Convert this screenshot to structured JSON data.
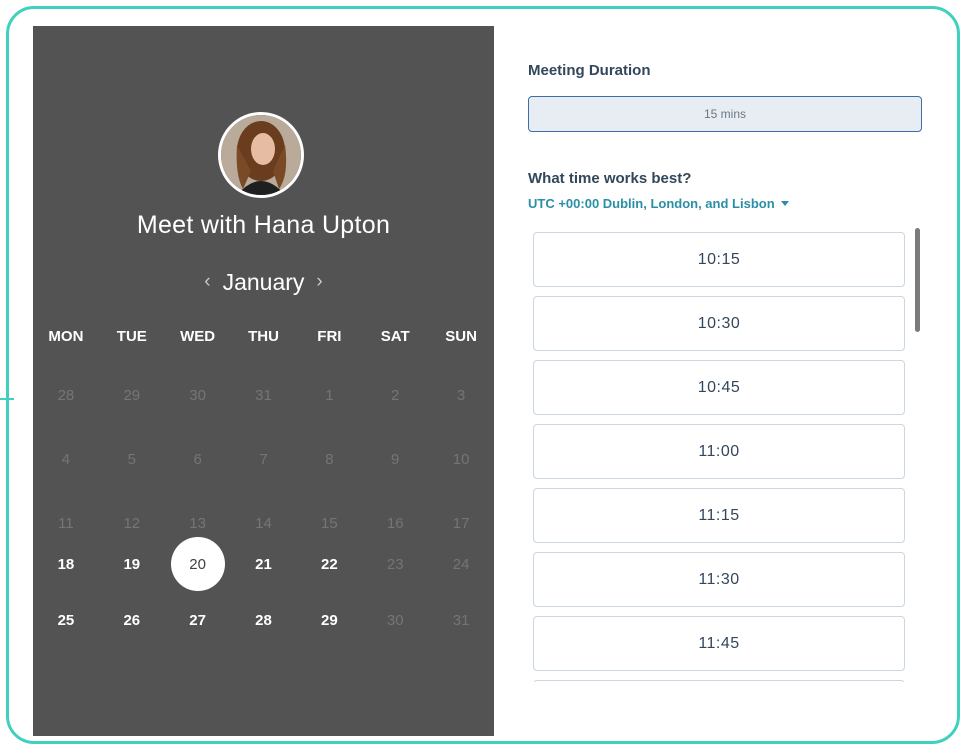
{
  "host": {
    "title": "Meet with Hana Upton"
  },
  "calendar": {
    "month": "January",
    "prev_icon": "chevron-left-icon",
    "next_icon": "chevron-right-icon",
    "weekdays": [
      "MON",
      "TUE",
      "WED",
      "THU",
      "FRI",
      "SAT",
      "SUN"
    ],
    "weeks": [
      [
        {
          "d": "28",
          "available": false
        },
        {
          "d": "29",
          "available": false
        },
        {
          "d": "30",
          "available": false
        },
        {
          "d": "31",
          "available": false
        },
        {
          "d": "1",
          "available": false
        },
        {
          "d": "2",
          "available": false
        },
        {
          "d": "3",
          "available": false
        }
      ],
      [
        {
          "d": "4",
          "available": false
        },
        {
          "d": "5",
          "available": false
        },
        {
          "d": "6",
          "available": false
        },
        {
          "d": "7",
          "available": false
        },
        {
          "d": "8",
          "available": false
        },
        {
          "d": "9",
          "available": false
        },
        {
          "d": "10",
          "available": false
        }
      ],
      [
        {
          "d": "11",
          "available": false
        },
        {
          "d": "12",
          "available": false
        },
        {
          "d": "13",
          "available": false
        },
        {
          "d": "14",
          "available": false
        },
        {
          "d": "15",
          "available": false
        },
        {
          "d": "16",
          "available": false
        },
        {
          "d": "17",
          "available": false
        }
      ],
      [
        {
          "d": "18",
          "available": true
        },
        {
          "d": "19",
          "available": true
        },
        {
          "d": "20",
          "available": true,
          "selected": true
        },
        {
          "d": "21",
          "available": true
        },
        {
          "d": "22",
          "available": true
        },
        {
          "d": "23",
          "available": false
        },
        {
          "d": "24",
          "available": false
        }
      ],
      [
        {
          "d": "25",
          "available": true
        },
        {
          "d": "26",
          "available": true
        },
        {
          "d": "27",
          "available": true
        },
        {
          "d": "28",
          "available": true
        },
        {
          "d": "29",
          "available": true
        },
        {
          "d": "30",
          "available": false
        },
        {
          "d": "31",
          "available": false
        }
      ]
    ]
  },
  "duration": {
    "label": "Meeting Duration",
    "value": "15 mins"
  },
  "times": {
    "label": "What time works best?",
    "timezone": "UTC +00:00 Dublin, London, and Lisbon",
    "slots": [
      "10:15",
      "10:30",
      "10:45",
      "11:00",
      "11:15",
      "11:30",
      "11:45",
      ""
    ]
  },
  "colors": {
    "accent_border": "#3fd0c0",
    "calendar_bg": "#535353",
    "link": "#2a8fa6",
    "duration_bg": "#e8ecf3"
  }
}
